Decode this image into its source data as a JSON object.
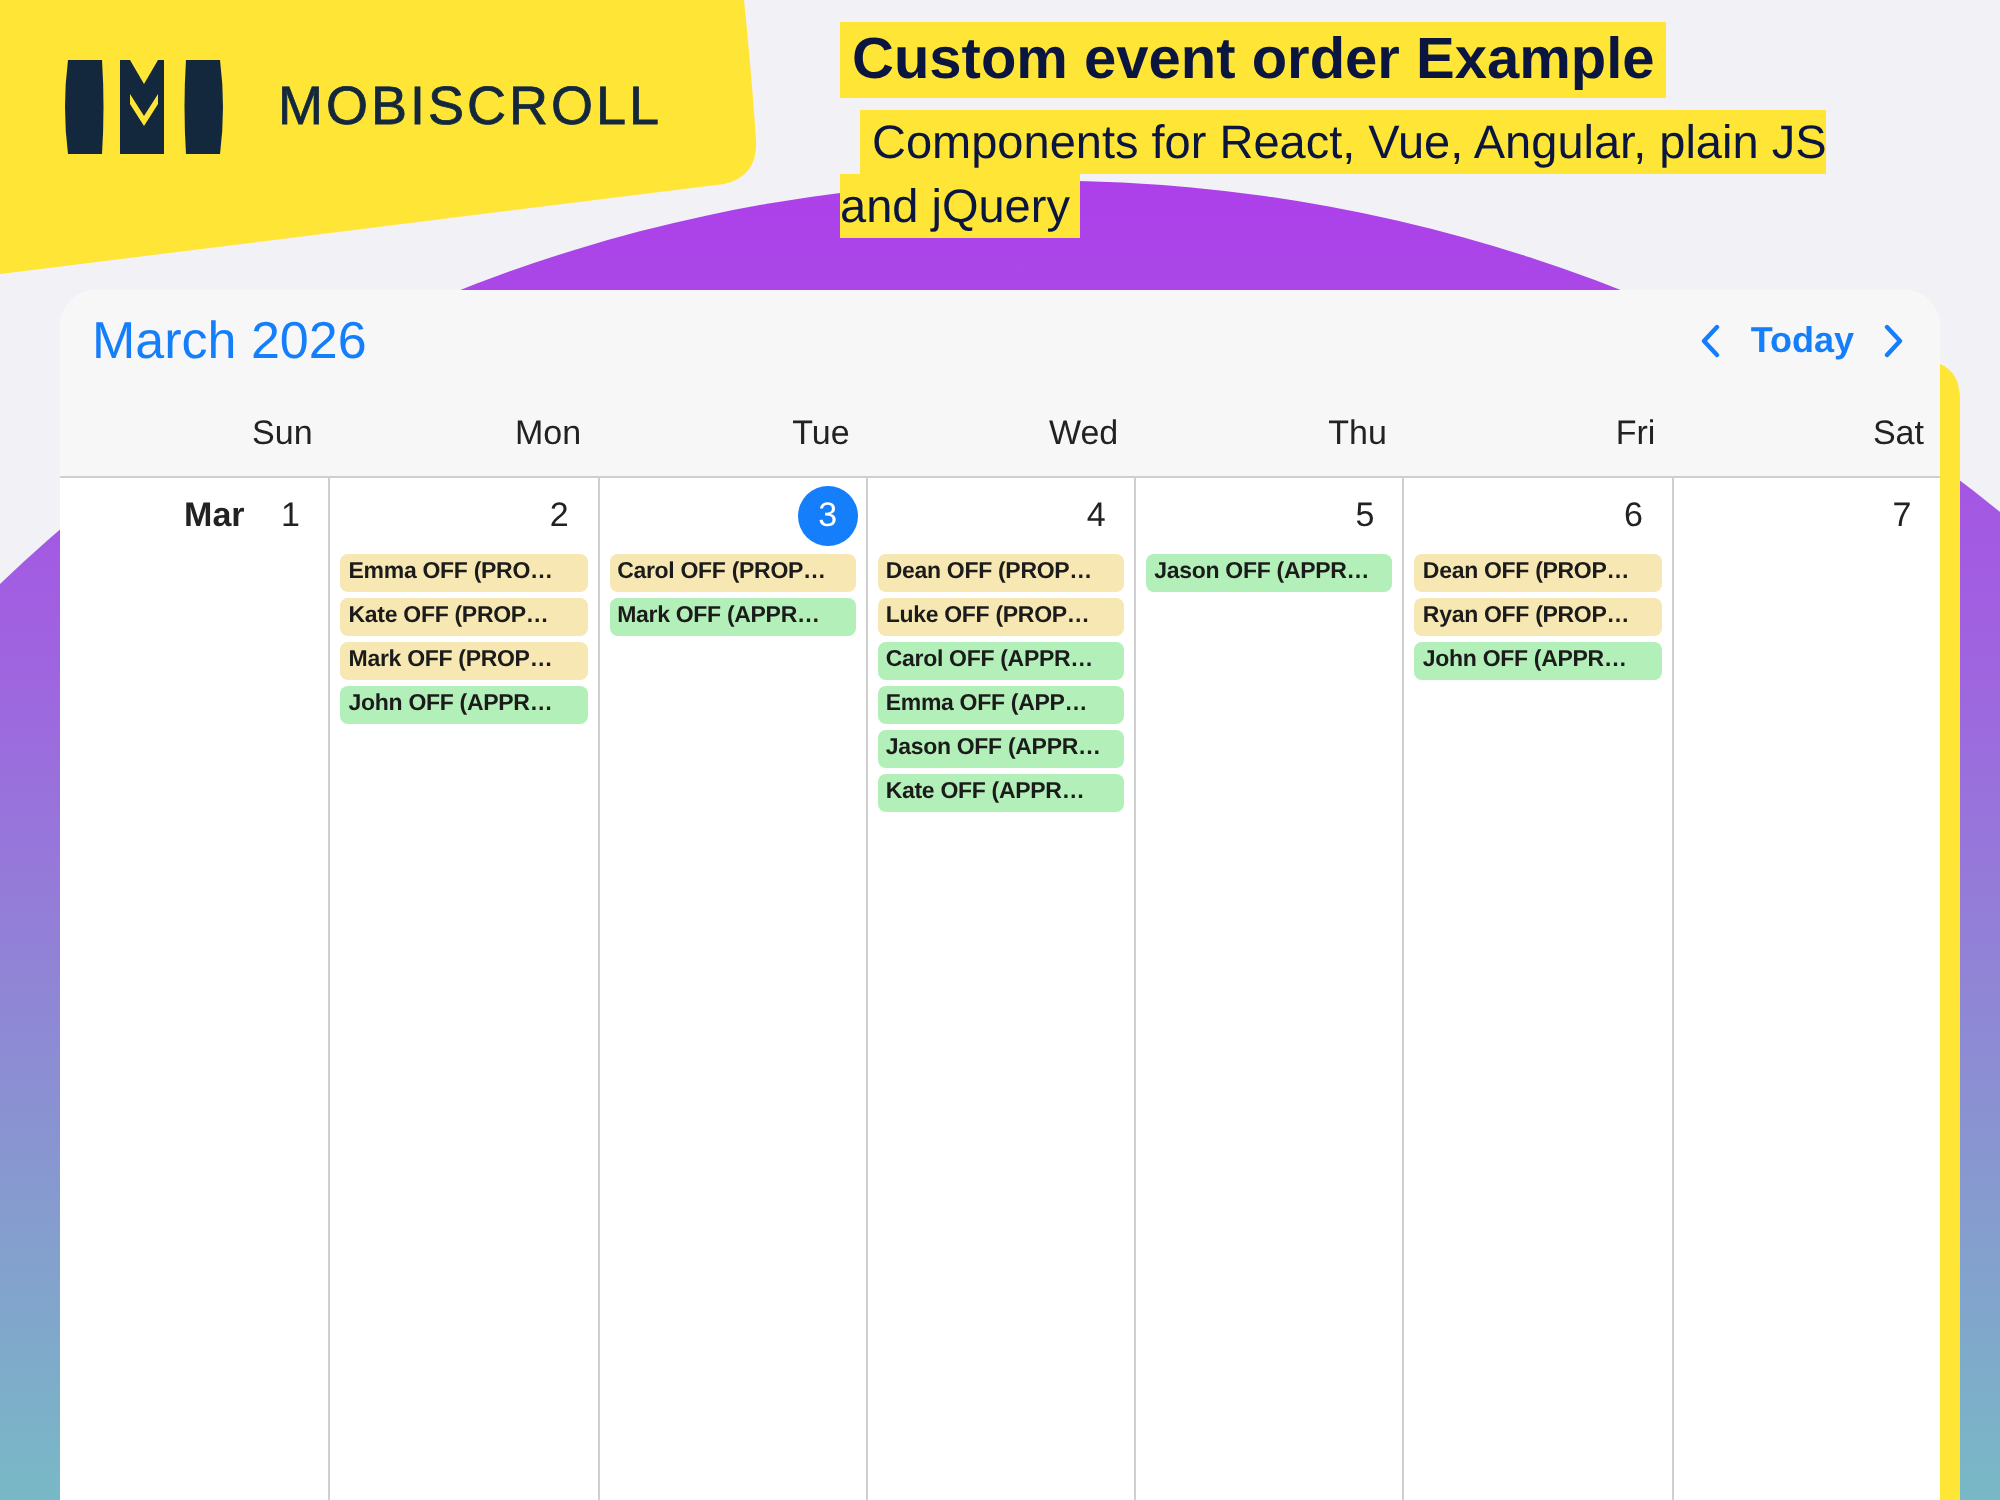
{
  "brand": {
    "name": "MOBISCROLL"
  },
  "heading": {
    "title": "Custom event order Example",
    "subtitle": "Components for React, Vue, Angular, plain JS and jQuery"
  },
  "calendar": {
    "title": "March 2026",
    "today_button": "Today",
    "weekdays": [
      "Sun",
      "Mon",
      "Tue",
      "Wed",
      "Thu",
      "Fri",
      "Sat"
    ],
    "days": [
      {
        "month_label": "Mar",
        "number": "1",
        "today": false
      },
      {
        "number": "2",
        "today": false,
        "events": [
          {
            "label": "Emma OFF (PRO…",
            "color": "#f7e7b2"
          },
          {
            "label": "Kate OFF (PROP…",
            "color": "#f7e7b2"
          },
          {
            "label": "Mark OFF (PROP…",
            "color": "#f7e7b2"
          },
          {
            "label": "John OFF (APPR…",
            "color": "#b3efb8"
          }
        ]
      },
      {
        "number": "3",
        "today": true,
        "events": [
          {
            "label": "Carol OFF (PROP…",
            "color": "#f7e7b2"
          },
          {
            "label": "Mark OFF (APPR…",
            "color": "#b3efb8"
          }
        ]
      },
      {
        "number": "4",
        "today": false,
        "events": [
          {
            "label": "Dean OFF (PROP…",
            "color": "#f7e7b2"
          },
          {
            "label": "Luke OFF (PROP…",
            "color": "#f7e7b2"
          },
          {
            "label": "Carol OFF (APPR…",
            "color": "#b3efb8"
          },
          {
            "label": "Emma OFF (APP…",
            "color": "#b3efb8"
          },
          {
            "label": "Jason OFF (APPR…",
            "color": "#b3efb8"
          },
          {
            "label": "Kate OFF (APPR…",
            "color": "#b3efb8"
          }
        ]
      },
      {
        "number": "5",
        "today": false,
        "events": [
          {
            "label": "Jason OFF (APPR…",
            "color": "#b3efb8"
          }
        ]
      },
      {
        "number": "6",
        "today": false,
        "events": [
          {
            "label": "Dean OFF (PROP…",
            "color": "#f7e7b2"
          },
          {
            "label": "Ryan OFF (PROP…",
            "color": "#f7e7b2"
          },
          {
            "label": "John OFF (APPR…",
            "color": "#b3efb8"
          }
        ]
      },
      {
        "number": "7",
        "today": false
      }
    ]
  }
}
